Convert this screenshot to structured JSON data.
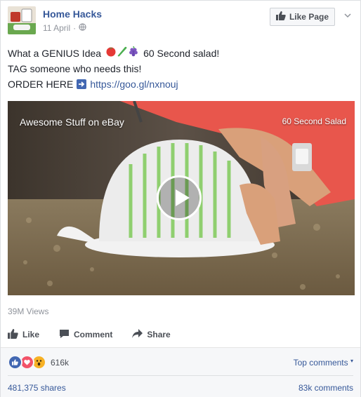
{
  "header": {
    "page_name": "Home Hacks",
    "date": "11 April",
    "separator": "·",
    "like_page_label": "Like Page"
  },
  "post": {
    "line1_text": "What a GENIUS Idea",
    "line1_emojis": [
      "tomato-emoji",
      "cucumber-emoji",
      "grapes-emoji"
    ],
    "line1_suffix": "60 Second salad!",
    "line2": "TAG someone who needs this!",
    "line3_prefix": "ORDER HERE",
    "line3_link": "https://goo.gl/nxnouj"
  },
  "video": {
    "caption_left": "Awesome Stuff on eBay",
    "caption_right": "60 Second Salad"
  },
  "stats": {
    "views": "39M Views"
  },
  "actions": {
    "like": "Like",
    "comment": "Comment",
    "share": "Share"
  },
  "reactions": {
    "types": [
      "like",
      "love",
      "wow"
    ],
    "count": "616k",
    "top_comments": "Top comments",
    "shares": "481,375 shares",
    "comments": "83k comments"
  },
  "colors": {
    "link": "#365899",
    "like_blue": "#4267b2",
    "love_red": "#f25268",
    "wow_yellow": "#f7b125"
  }
}
